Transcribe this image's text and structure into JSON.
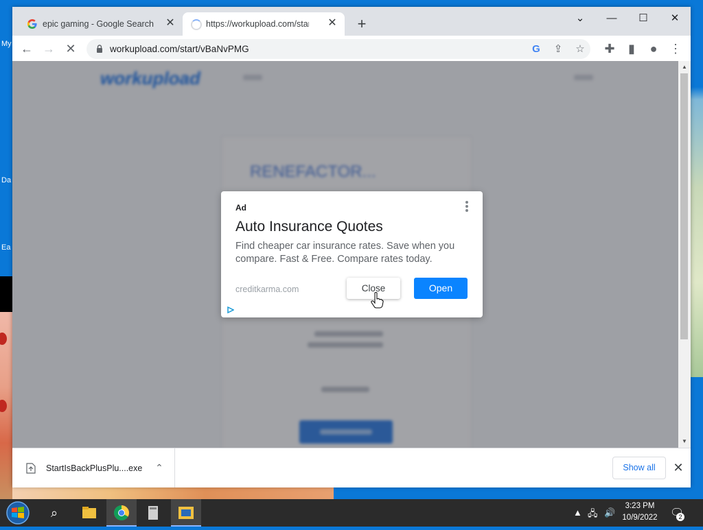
{
  "desktop": {
    "labels": [
      "My",
      "Da",
      "Ea"
    ]
  },
  "browser": {
    "tabs": [
      {
        "title": "epic gaming - Google Search",
        "favicon": "google-icon"
      },
      {
        "title": "https://workupload.com/start/vBaNvPMG",
        "favicon": "loading-spinner-icon"
      }
    ],
    "window_controls": {
      "minimize": "—",
      "maximize": "☐",
      "close": "✕",
      "tab_search": "⌄"
    },
    "url": "workupload.com/start/vBaNvPMG",
    "nav": {
      "back": "←",
      "forward": "→",
      "stop": "✕"
    }
  },
  "page": {
    "site_name": "workupload",
    "heading": "RENEFACTOR..."
  },
  "ad": {
    "label": "Ad",
    "title": "Auto Insurance Quotes",
    "description": "Find cheaper car insurance rates. Save when you compare. Fast & Free. Compare rates today.",
    "domain": "creditkarma.com",
    "close_label": "Close",
    "open_label": "Open"
  },
  "download_bar": {
    "file_name": "StartIsBackPlusPlu....exe",
    "show_all_label": "Show all"
  },
  "taskbar": {
    "clock_time": "3:23 PM",
    "clock_date": "10/9/2022",
    "notification_count": "2"
  },
  "colors": {
    "accent": "#1a73e8",
    "ad_open_button": "#0a84ff",
    "desktop": "#0a78d7",
    "taskbar": "#2b2b2b"
  }
}
